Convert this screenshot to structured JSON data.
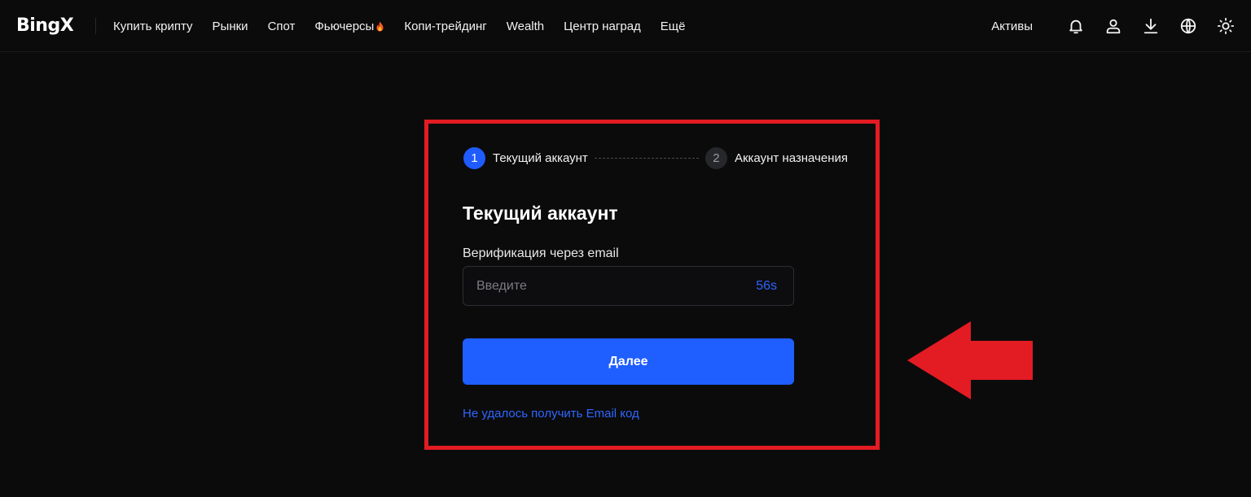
{
  "header": {
    "logo": "BingX",
    "nav": [
      {
        "label": "Купить крипту"
      },
      {
        "label": "Рынки"
      },
      {
        "label": "Спот"
      },
      {
        "label": "Фьючерсы",
        "icon": "fire-icon"
      },
      {
        "label": "Копи-трейдинг"
      },
      {
        "label": "Wealth"
      },
      {
        "label": "Центр наград"
      },
      {
        "label": "Ещё"
      }
    ],
    "assets_label": "Активы",
    "icons": [
      "bell-icon",
      "user-icon",
      "download-icon",
      "globe-icon",
      "sun-icon"
    ]
  },
  "steps": [
    {
      "number": "1",
      "label": "Текущий аккаунт",
      "state": "active"
    },
    {
      "number": "2",
      "label": "Аккаунт назначения",
      "state": "inactive"
    }
  ],
  "form": {
    "title": "Текущий аккаунт",
    "field_label": "Верификация через email",
    "input_placeholder": "Введите",
    "input_value": "",
    "timer": "56s",
    "submit_label": "Далее",
    "help_link": "Не удалось получить Email код"
  },
  "annotation": {
    "highlight_color": "#e31b23",
    "arrow_color": "#e31b23"
  },
  "colors": {
    "accent": "#1f5eff",
    "background": "#0b0b0c"
  }
}
